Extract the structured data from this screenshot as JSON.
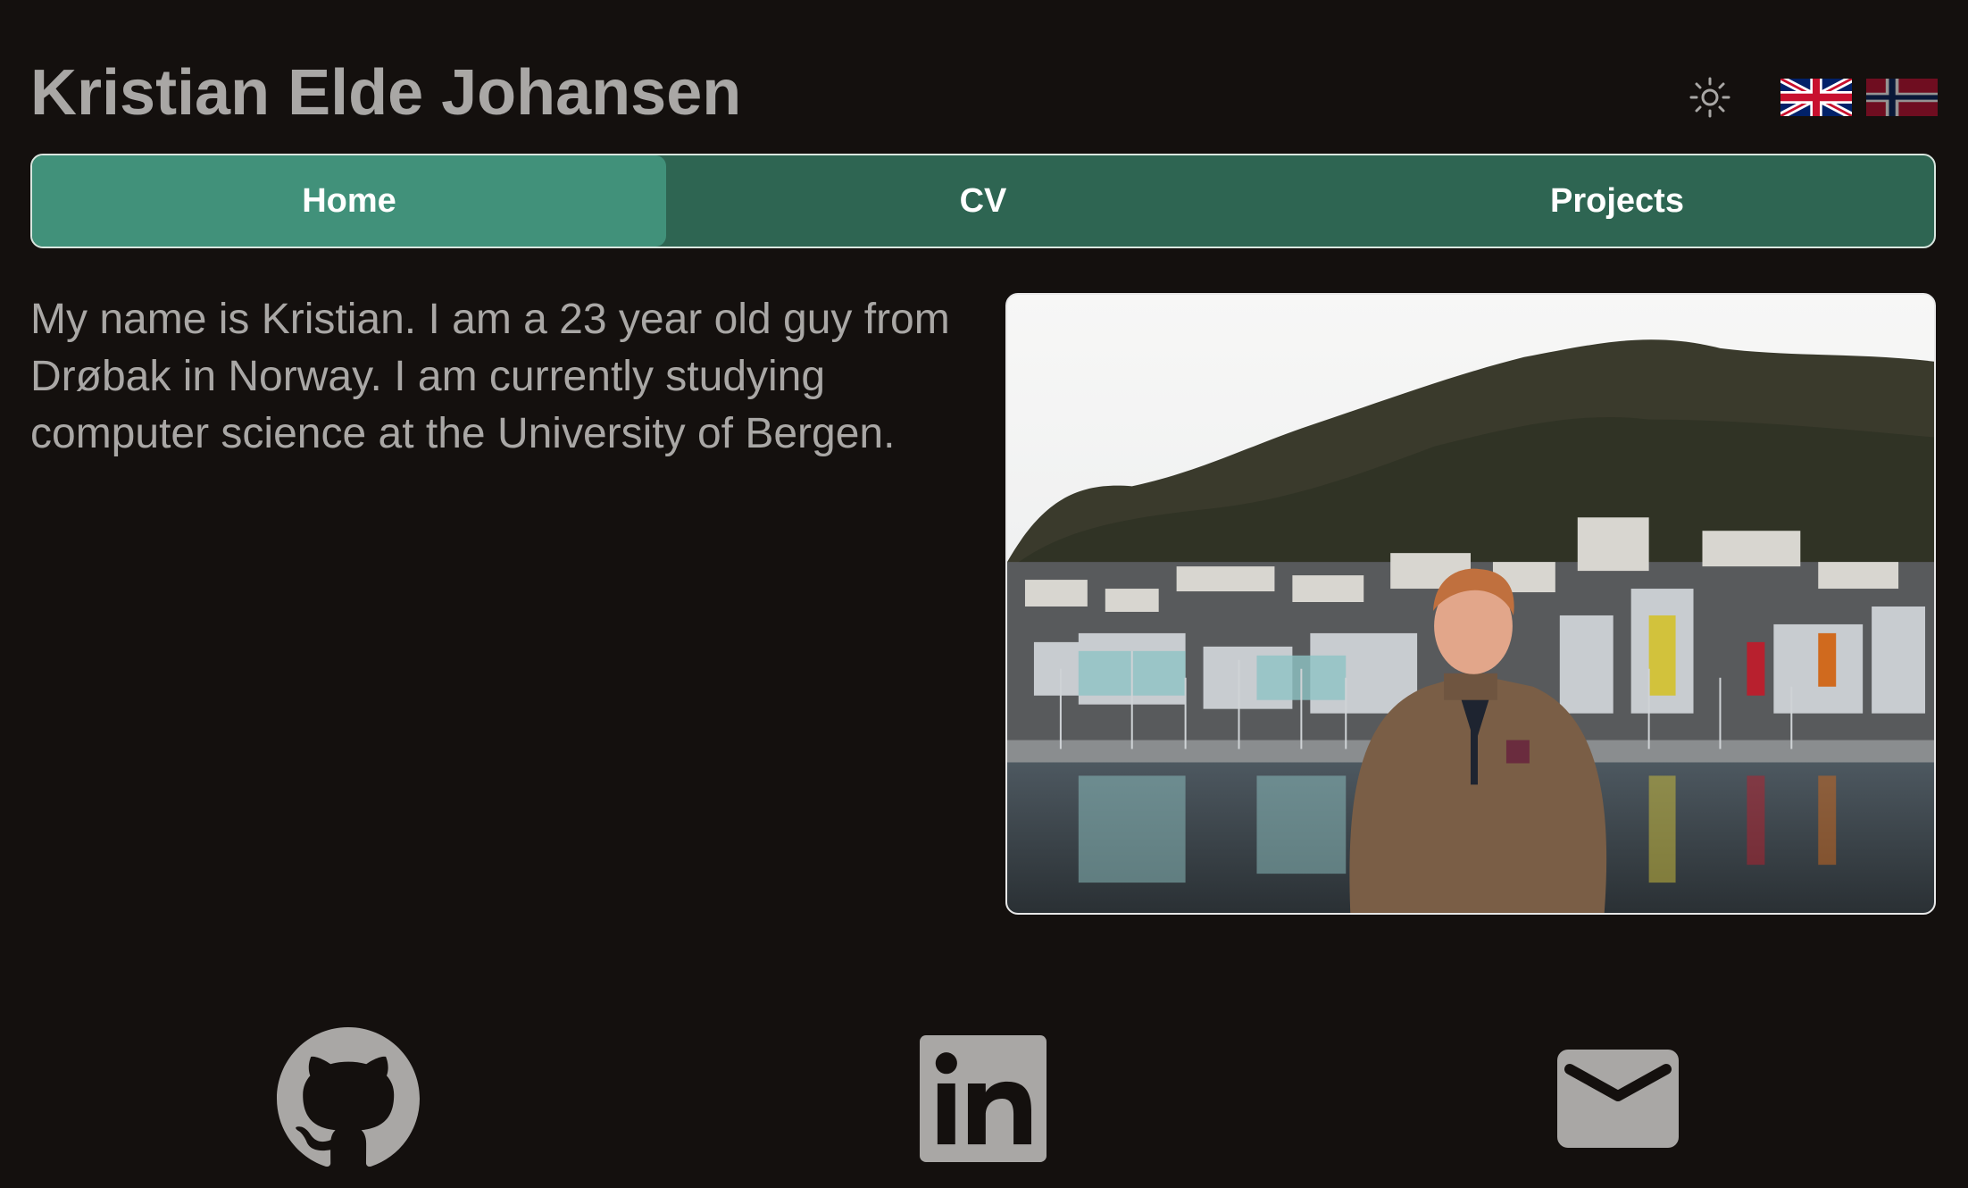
{
  "header": {
    "title": "Kristian Elde Johansen",
    "theme_icon": "sun-icon",
    "languages": [
      {
        "code": "en",
        "flag": "uk-flag-icon",
        "selected": true
      },
      {
        "code": "no",
        "flag": "norway-flag-icon",
        "selected": false
      }
    ]
  },
  "nav": {
    "tabs": [
      {
        "label": "Home",
        "active": true
      },
      {
        "label": "CV",
        "active": false
      },
      {
        "label": "Projects",
        "active": false
      }
    ]
  },
  "main": {
    "intro": "My name is Kristian. I am a 23 year old guy from Drøbak in Norway. I am currently studying computer science at the University of Bergen.",
    "photo_icon": "portrait-photo"
  },
  "social": {
    "links": [
      {
        "icon": "github-icon"
      },
      {
        "icon": "linkedin-icon"
      },
      {
        "icon": "email-icon"
      }
    ]
  },
  "colors": {
    "background": "#14100e",
    "text": "#a9a7a5",
    "nav_bg": "#2e6552",
    "nav_active": "#41917a"
  }
}
